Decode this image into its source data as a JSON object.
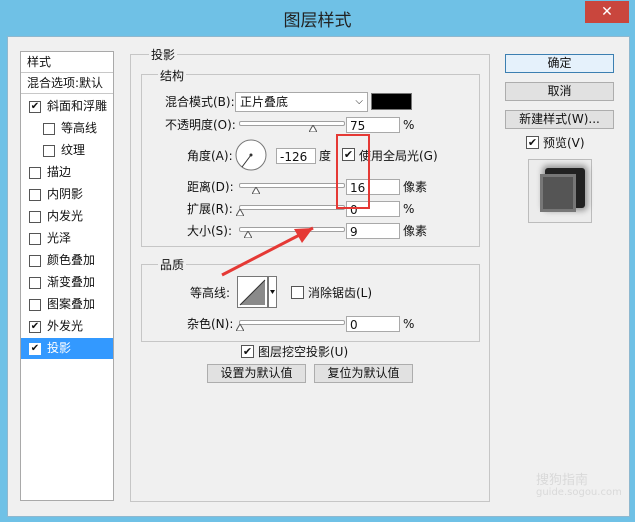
{
  "window": {
    "title": "图层样式",
    "close_glyph": "✕"
  },
  "left_list": {
    "header": "样式",
    "subheader": "混合选项:默认",
    "items": [
      {
        "label": "斜面和浮雕",
        "checked": true,
        "indent": false
      },
      {
        "label": "等高线",
        "checked": false,
        "indent": true
      },
      {
        "label": "纹理",
        "checked": false,
        "indent": true
      },
      {
        "label": "描边",
        "checked": false,
        "indent": false
      },
      {
        "label": "内阴影",
        "checked": false,
        "indent": false
      },
      {
        "label": "内发光",
        "checked": false,
        "indent": false
      },
      {
        "label": "光泽",
        "checked": false,
        "indent": false
      },
      {
        "label": "颜色叠加",
        "checked": false,
        "indent": false
      },
      {
        "label": "渐变叠加",
        "checked": false,
        "indent": false
      },
      {
        "label": "图案叠加",
        "checked": false,
        "indent": false
      },
      {
        "label": "外发光",
        "checked": true,
        "indent": false
      },
      {
        "label": "投影",
        "checked": true,
        "indent": false,
        "selected": true
      }
    ]
  },
  "shadow": {
    "title": "投影",
    "structure": {
      "title": "结构",
      "blend_mode_label": "混合模式(B):",
      "blend_mode_value": "正片叠底",
      "color": "#000000",
      "opacity_label": "不透明度(O):",
      "opacity_value": "75",
      "percent": "%",
      "angle_label": "角度(A):",
      "angle_value": "-126",
      "angle_unit": "度",
      "global_light_label": "使用全局光(G)",
      "global_light_checked": true,
      "distance_label": "距离(D):",
      "distance_value": "16",
      "spread_label": "扩展(R):",
      "spread_value": "0",
      "size_label": "大小(S):",
      "size_value": "9",
      "pixel_unit": "像素"
    },
    "quality": {
      "title": "品质",
      "contour_label": "等高线:",
      "antialias_label": "消除锯齿(L)",
      "antialias_checked": false,
      "noise_label": "杂色(N):",
      "noise_value": "0",
      "knockout_label": "图层挖空投影(U)",
      "knockout_checked": true,
      "set_default": "设置为默认值",
      "reset_default": "复位为默认值"
    }
  },
  "right_buttons": {
    "ok": "确定",
    "cancel": "取消",
    "new_style": "新建样式(W)...",
    "preview_label": "预览(V)",
    "preview_checked": true
  },
  "watermark": {
    "line1": "搜狗指南",
    "line2": "guide.sogou.com"
  },
  "colors": {
    "titlebar": "#6fc1e6",
    "close": "#c9463d",
    "selection": "#3399ff",
    "highlight_box": "#e53935",
    "arrow": "#e53935"
  }
}
